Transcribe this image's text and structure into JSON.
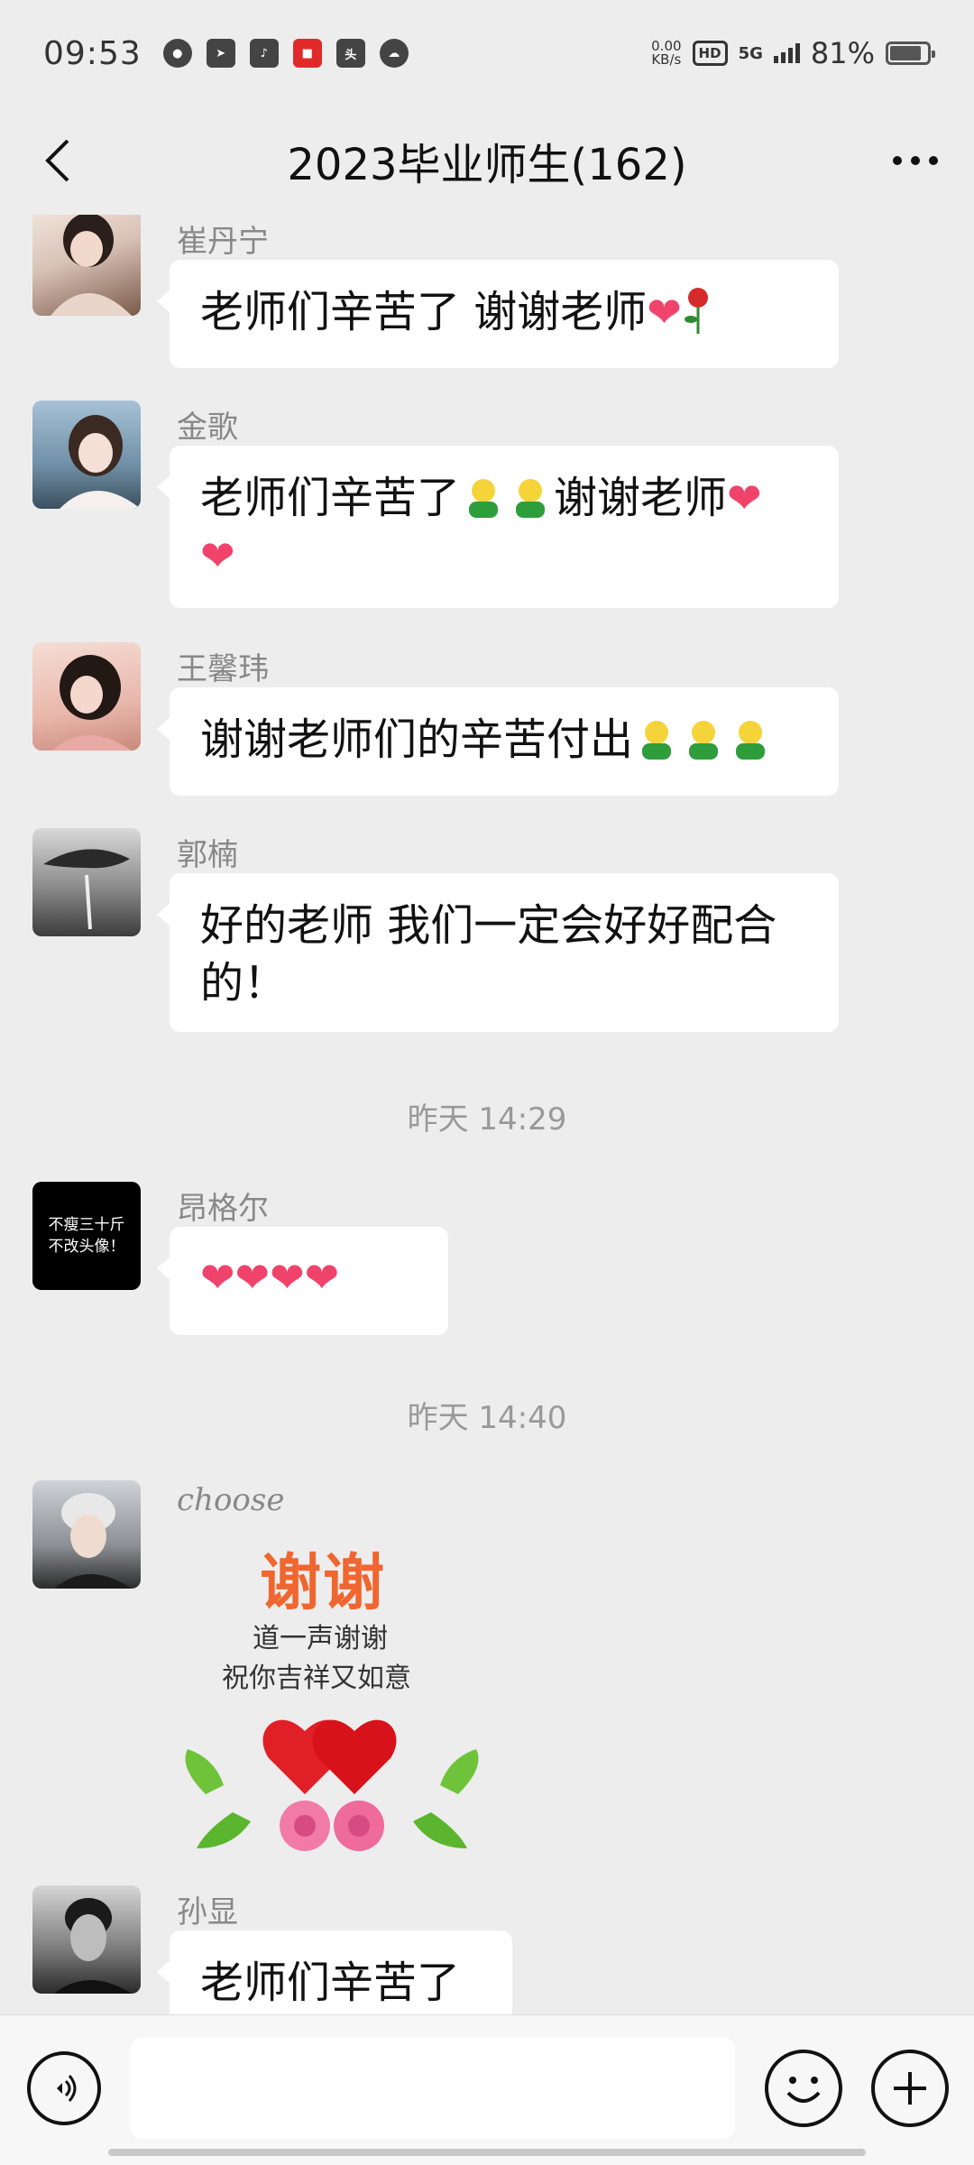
{
  "status_bar": {
    "time": "09:53",
    "net_speed": "0.00",
    "net_unit": "KB/s",
    "hd": "HD",
    "network": "5G",
    "battery": "81%"
  },
  "header": {
    "title": "2023毕业师生(162)"
  },
  "messages": [
    {
      "sender": "崔丹宁",
      "text": "老师们辛苦了 谢谢老师",
      "emoji": [
        "heart-emoji",
        "rose-emoji"
      ]
    },
    {
      "sender": "金歌",
      "text1": "老师们辛苦了",
      "text2": "谢谢老师",
      "emoji": [
        "sprout-emoji",
        "sprout-emoji",
        "heart-emoji",
        "heart-emoji"
      ]
    },
    {
      "sender": "王馨玮",
      "text": "谢谢老师们的辛苦付出",
      "emoji": [
        "sprout-emoji",
        "sprout-emoji",
        "sprout-emoji"
      ]
    },
    {
      "sender": "郭楠",
      "text_line1": "好的老师 我们一定会好好配合",
      "text_line2": "的！"
    },
    {
      "sender": "昂格尔",
      "emoji": [
        "heart-emoji",
        "heart-emoji",
        "heart-emoji",
        "heart-emoji"
      ],
      "avatar_text_line1": "不瘦三十斤",
      "avatar_text_line2": "不改头像！"
    },
    {
      "sender": "choose",
      "sticker_title": "谢谢",
      "sticker_line1": "道一声谢谢",
      "sticker_line2": "祝你吉祥又如意"
    },
    {
      "sender": "孙显",
      "text": "老师们辛苦了"
    }
  ],
  "timestamps": [
    "昨天 14:29",
    "昨天 14:40"
  ],
  "colors": {
    "background": "#ededed",
    "bubble": "#ffffff",
    "heart": "#f0436b"
  }
}
